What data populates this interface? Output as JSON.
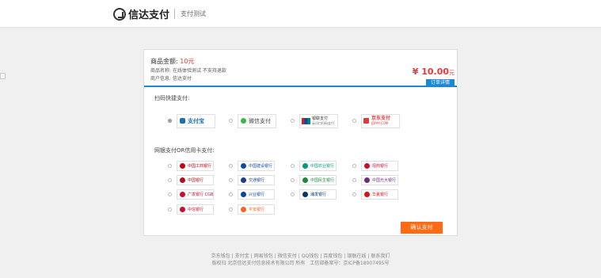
{
  "header": {
    "brand": "信达支付",
    "subtitle": "支付测试"
  },
  "order": {
    "amount_label": "商品金额:",
    "amount_value": "10元",
    "product_label": "商品名称:",
    "product_value": "在线体验测试 不支持退款",
    "merchant_label": "商户信息:",
    "merchant_value": "信达支付",
    "total_value": "¥ 10.00",
    "total_unit": "元",
    "detail_button": "订单详情"
  },
  "scan_section": {
    "title": "扫码快捷支付:",
    "options": [
      {
        "name": "alipay",
        "label": "支付宝",
        "color": "#1a6fb5",
        "selected": true
      },
      {
        "name": "wechat",
        "label": "微信支付",
        "color": "#39b54a",
        "selected": false
      },
      {
        "name": "unionpay",
        "label": "银联支付",
        "sub": "云闪付扫码支付",
        "color": "#d6221a",
        "selected": false
      },
      {
        "name": "jdpay",
        "label": "京东支付",
        "sub": "JDPAY.COM",
        "color": "#e4393c",
        "selected": false
      }
    ]
  },
  "bank_section": {
    "title": "网银支付OR信用卡支付:",
    "banks": [
      {
        "label": "中国工商银行",
        "color": "#c7000b"
      },
      {
        "label": "中国建设银行",
        "color": "#0d4da1"
      },
      {
        "label": "中国农业银行",
        "color": "#009a83"
      },
      {
        "label": "招商银行",
        "color": "#c8102e"
      },
      {
        "label": "中国银行",
        "color": "#b10e1c"
      },
      {
        "label": "交通银行",
        "color": "#1b3f8f"
      },
      {
        "label": "中国民生银行",
        "color": "#1c8a3a"
      },
      {
        "label": "中国光大银行",
        "color": "#6d2a85"
      },
      {
        "label": "广发银行 CGB",
        "color": "#c8102e"
      },
      {
        "label": "兴业银行",
        "color": "#00479d"
      },
      {
        "label": "浦发银行",
        "color": "#00356b"
      },
      {
        "label": "华夏银行",
        "color": "#d6121a"
      },
      {
        "label": "中信银行",
        "color": "#c8102e"
      },
      {
        "label": "平安银行",
        "color": "#f26522"
      }
    ]
  },
  "confirm_button": "确认支付",
  "footer": {
    "links": [
      "京东钱包",
      "支付宝",
      "网易钱包",
      "微信支付",
      "QQ钱包",
      "百度钱包",
      "银联在线",
      "联系我们"
    ],
    "copyright": "版权归 北京信达支付信息技术有限公司 所有　工信部备案号：京ICP备18007495号"
  }
}
